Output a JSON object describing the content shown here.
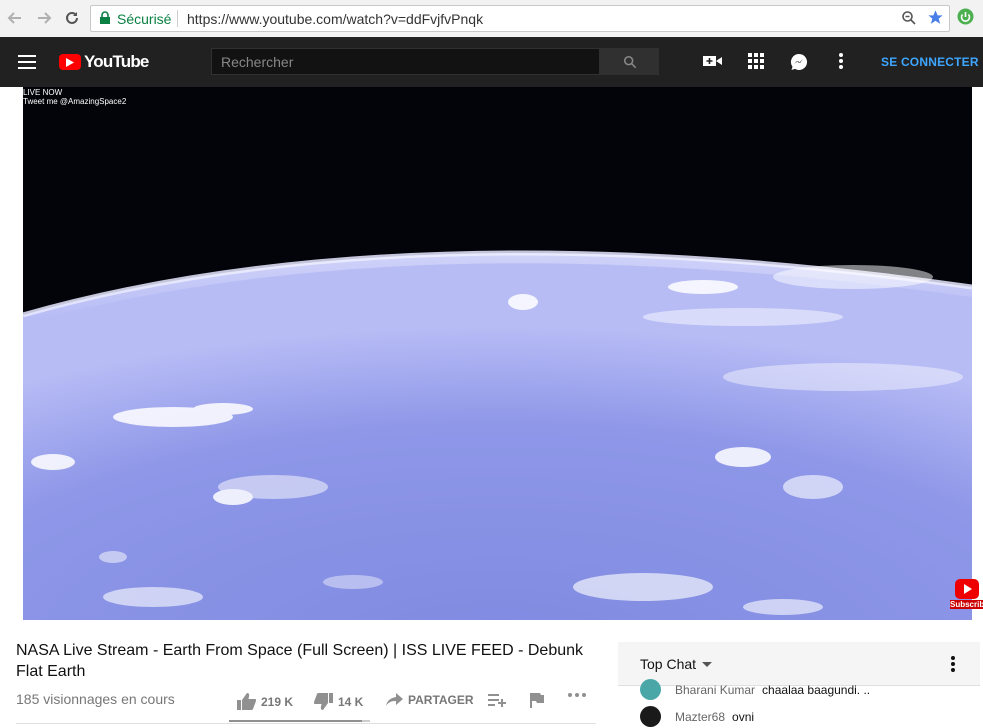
{
  "browser": {
    "secure_label": "Sécurisé",
    "url": "https://www.youtube.com/watch?v=ddFvjfvPnqk",
    "icons": [
      "back-arrow-icon",
      "forward-arrow-icon",
      "reload-icon",
      "lock-icon",
      "zoom-icon",
      "star-icon",
      "extension-icon"
    ]
  },
  "header": {
    "logo_text": "YouTube",
    "search_placeholder": "Rechercher",
    "signin_label": "SE CONNECTER",
    "icons": [
      "hamburger-icon",
      "search-icon",
      "upload-video-icon",
      "apps-grid-icon",
      "messages-icon",
      "more-vert-icon"
    ]
  },
  "player": {
    "overlay_line1": "LIVE NOW",
    "overlay_line2": "Tweet me @AmazingSpace2",
    "subscribe_label": "Subscrib"
  },
  "video": {
    "title": "NASA Live Stream - Earth From Space (Full Screen) | ISS LIVE FEED - Debunk Flat Earth",
    "view_count": "185 visionnages en cours",
    "likes": "219 K",
    "dislikes": "14 K",
    "share_label": "PARTAGER",
    "like_ratio": 0.94
  },
  "chat": {
    "mode_label": "Top Chat",
    "messages": [
      {
        "author": "Bharani Kumar",
        "text": "chaalaa baagundi. ..",
        "avatar_color": "#4aa7a8"
      },
      {
        "author": "Mazter68",
        "text": "ovni",
        "avatar_color": "#1a1a1a"
      }
    ]
  },
  "colors": {
    "youtube_red": "#ff0000",
    "header_bg": "#212121",
    "link_blue": "#3ea6ff",
    "secure_green": "#0b8043"
  }
}
